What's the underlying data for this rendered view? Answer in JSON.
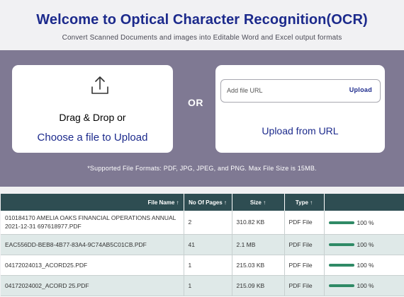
{
  "header": {
    "title": "Welcome to Optical Character Recognition(OCR)",
    "subtitle": "Convert Scanned Documents and images into Editable Word and Excel output formats"
  },
  "upload": {
    "drag_label": "Drag & Drop or",
    "choose_label": "Choose a file to Upload",
    "or_label": "OR",
    "url_placeholder": "Add file URL",
    "url_upload_button": "Upload",
    "upload_from_url_label": "Upload from URL",
    "supported_formats": "*Supported File Formats: PDF, JPG, JPEG, and PNG. Max File Size is 15MB."
  },
  "table": {
    "columns": [
      "File Name ↑",
      "No Of Pages ↑",
      "Size ↑",
      "Type ↑",
      ""
    ],
    "rows": [
      {
        "name": "010184170 AMELIA OAKS FINANCIAL OPERATIONS ANNUAL 2021-12-31 697618977.PDF",
        "pages": "2",
        "size": "310.82 KB",
        "type": "PDF File",
        "progress": "100 %",
        "progress_value": 1.0
      },
      {
        "name": "EAC556DD-BEB8-4B77-83A4-9C74AB5C01CB.PDF",
        "pages": "41",
        "size": "2.1 MB",
        "type": "PDF File",
        "progress": "100 %",
        "progress_value": 1.0
      },
      {
        "name": "04172024013_ACORD25.PDF",
        "pages": "1",
        "size": "215.03 KB",
        "type": "PDF File",
        "progress": "100 %",
        "progress_value": 1.0
      },
      {
        "name": "04172024002_ACORD 25.PDF",
        "pages": "1",
        "size": "215.09 KB",
        "type": "PDF File",
        "progress": "100 %",
        "progress_value": 1.0
      }
    ]
  },
  "colors": {
    "accent": "#1c2a8c",
    "band": "#7f7993",
    "table_header": "#2e4d52",
    "progress": "#2f8a66"
  }
}
